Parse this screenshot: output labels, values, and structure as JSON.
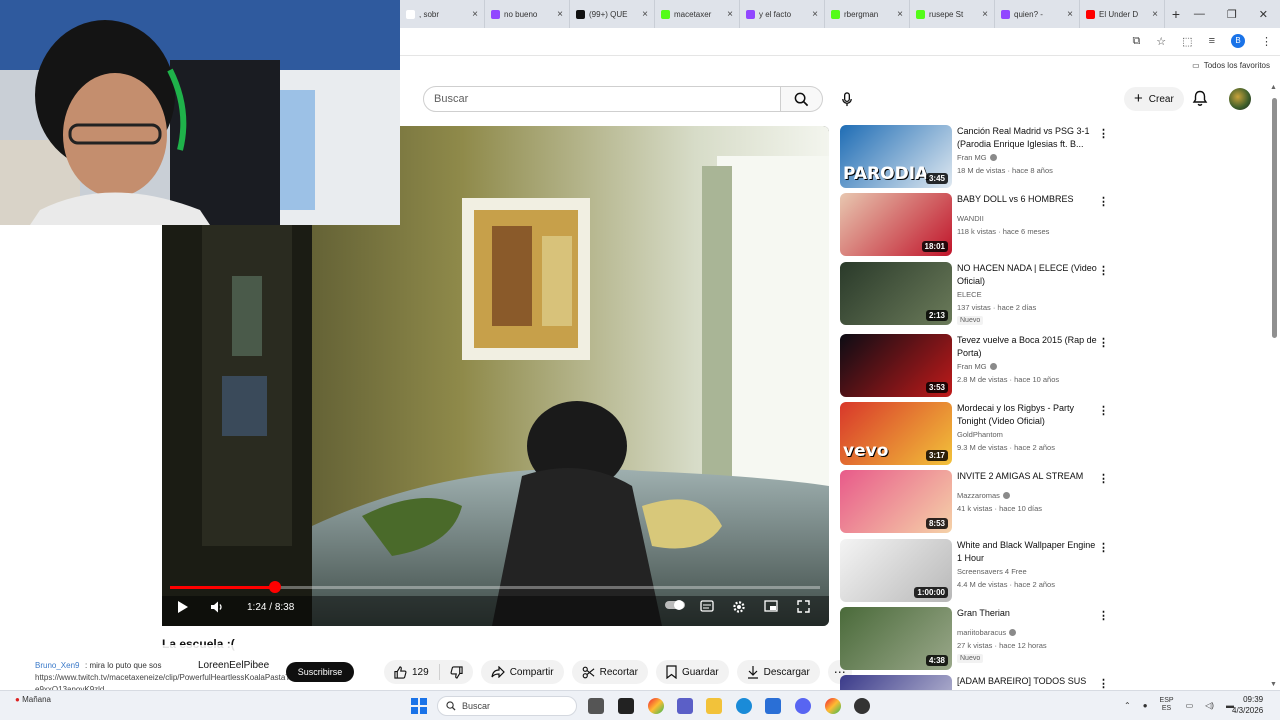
{
  "browser": {
    "tabs": [
      {
        "label": ", sobr",
        "color": "#ffffff"
      },
      {
        "label": "no bueno",
        "color": "#9146ff"
      },
      {
        "label": "(99+) QUE",
        "color": "#111111"
      },
      {
        "label": "macetaxer",
        "color": "#53fc18"
      },
      {
        "label": "y el facto",
        "color": "#9146ff"
      },
      {
        "label": "rbergman",
        "color": "#53fc18"
      },
      {
        "label": "rusepe St",
        "color": "#53fc18"
      },
      {
        "label": "quien? -",
        "color": "#9146ff"
      },
      {
        "label": "El Under D",
        "color": "#ff0000"
      }
    ],
    "bookmarks_all": "Todos los favoritos",
    "profile_initial": "B"
  },
  "youtube": {
    "search_placeholder": "Buscar",
    "create_label": "Crear"
  },
  "player": {
    "current_time": "1:24",
    "duration": "8:38",
    "progress_fraction": 0.162
  },
  "video": {
    "title": "La escuela :(",
    "like_count": "129",
    "share_label": "Compartir",
    "clip_label": "Recortar",
    "save_label": "Guardar",
    "download_label": "Descargar"
  },
  "chat": {
    "user": "Bruno_Xen9",
    "message": ": mira lo puto que sos",
    "url_line1": "https://www.twitch.tv/macetaxeneize/clip/PowerfulHeartlessKoalaPastaThat-",
    "url_line2": "e9xxQ13anovK9zld",
    "channel_name": "LoreenEelPibee",
    "subscribe_label": "Suscribirse"
  },
  "recommendations": [
    {
      "title": "Canción Real Madrid vs PSG 3-1 (Parodia Enrique Iglesias ft. B...",
      "channel": "Fran MG",
      "verified": true,
      "meta": "18 M de vistas · hace 8 años",
      "duration": "3:45",
      "badge": "",
      "thumb_text": "PARODIA",
      "color1": "#1f6db5",
      "color2": "#dfe8f0"
    },
    {
      "title": "BABY DOLL vs 6 HOMBRES",
      "channel": "WANDII",
      "verified": false,
      "meta": "118 k vistas · hace 6 meses",
      "duration": "18:01",
      "badge": "",
      "thumb_text": "",
      "color1": "#e8c7b0",
      "color2": "#c0142a"
    },
    {
      "title": "NO HACEN NADA | ELECE (Video Oficial)",
      "channel": "ELECE",
      "verified": false,
      "meta": "137 vistas · hace 2 días",
      "duration": "2:13",
      "badge": "Nuevo",
      "thumb_text": "",
      "color1": "#2a3a2a",
      "color2": "#6b7b5a"
    },
    {
      "title": "Tevez vuelve a Boca 2015 (Rap de Porta)",
      "channel": "Fran MG",
      "verified": true,
      "meta": "2.8 M de vistas · hace 10 años",
      "duration": "3:53",
      "badge": "",
      "thumb_text": "",
      "color1": "#0c0c14",
      "color2": "#c01a1a"
    },
    {
      "title": "Mordecai y los Rigbys - Party Tonight (Video Oficial)",
      "channel": "GoldPhantom",
      "verified": false,
      "meta": "9.3 M de vistas · hace 2 años",
      "duration": "3:17",
      "badge": "",
      "thumb_text": "vevo",
      "color1": "#d8372a",
      "color2": "#f2c23a"
    },
    {
      "title": "INVITE 2 AMIGAS AL STREAM",
      "channel": "Mazzaromas",
      "verified": true,
      "meta": "41 k vistas · hace 10 días",
      "duration": "8:53",
      "badge": "",
      "thumb_text": "",
      "color1": "#e85a8a",
      "color2": "#f5d2a8"
    },
    {
      "title": "White and Black Wallpaper Engine 1 Hour",
      "channel": "Screensavers 4 Free",
      "verified": false,
      "meta": "4.4 M de vistas · hace 2 años",
      "duration": "1:00:00",
      "badge": "",
      "thumb_text": "",
      "color1": "#f4f4f4",
      "color2": "#b8b8b8"
    },
    {
      "title": "Gran Therian",
      "channel": "mariitobaracus",
      "verified": true,
      "meta": "27 k vistas · hace 12 horas",
      "duration": "4:38",
      "badge": "Nuevo",
      "thumb_text": "",
      "color1": "#4a6a3a",
      "color2": "#9aa88a"
    },
    {
      "title": "[ADAM BAREIRO] TODOS SUS",
      "channel": "",
      "verified": false,
      "meta": "",
      "duration": "",
      "badge": "",
      "thumb_text": "",
      "color1": "#3a3a8a",
      "color2": "#d0d0e0"
    }
  ],
  "taskbar": {
    "weather_line1": "Mañana",
    "search_label": "Buscar",
    "lang": "ESP",
    "region": "ES",
    "time": "09:39",
    "date": "4/3/2026"
  }
}
